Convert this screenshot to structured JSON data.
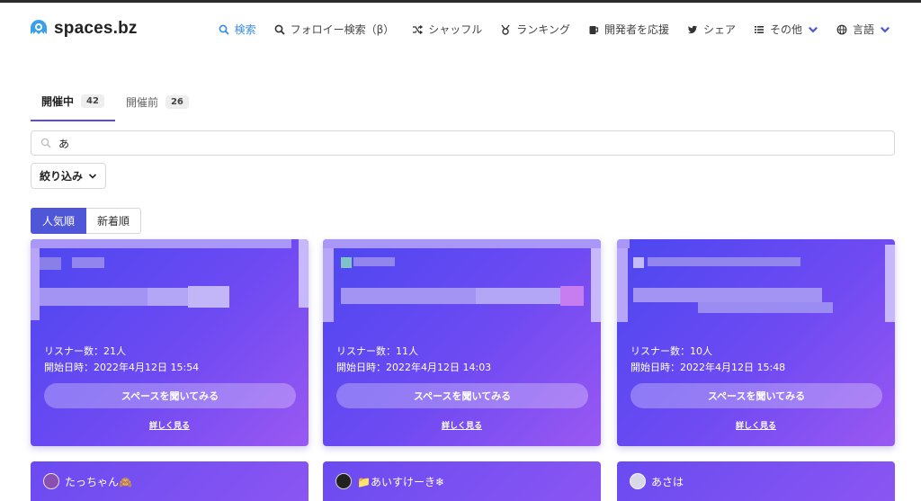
{
  "header": {
    "logo_text": "spaces.bz",
    "nav": {
      "search": "検索",
      "follow_search": "フォロイー検索（β）",
      "shuffle": "シャッフル",
      "ranking": "ランキング",
      "support": "開発者を応援",
      "share": "シェア",
      "more": "その他",
      "language": "言語"
    }
  },
  "tabs": [
    {
      "label": "開催中",
      "count": "42"
    },
    {
      "label": "開催前",
      "count": "26"
    }
  ],
  "search": {
    "value": "あ"
  },
  "filter_label": "絞り込み",
  "sort": {
    "popular": "人気順",
    "newest": "新着順"
  },
  "cards": [
    {
      "listeners": "リスナー数：21人",
      "started": "開始日時：2022年4月12日 15:54",
      "button": "スペースを聞いてみる",
      "detail": "詳しく見る"
    },
    {
      "listeners": "リスナー数：11人",
      "started": "開始日時：2022年4月12日 14:03",
      "button": "スペースを聞いてみる",
      "detail": "詳しく見る"
    },
    {
      "listeners": "リスナー数：10人",
      "started": "開始日時：2022年4月12日 15:48",
      "button": "スペースを聞いてみる",
      "detail": "詳しく見る"
    }
  ],
  "next_cards": [
    {
      "host": "たっちゃん🙈"
    },
    {
      "host": "📁あいすけーき❄"
    },
    {
      "host": "あさは"
    }
  ],
  "colors": {
    "accent": "#4f57d8",
    "active_nav": "#3a8de0",
    "card_start": "#4c47f0",
    "card_end": "#9a58f2"
  }
}
